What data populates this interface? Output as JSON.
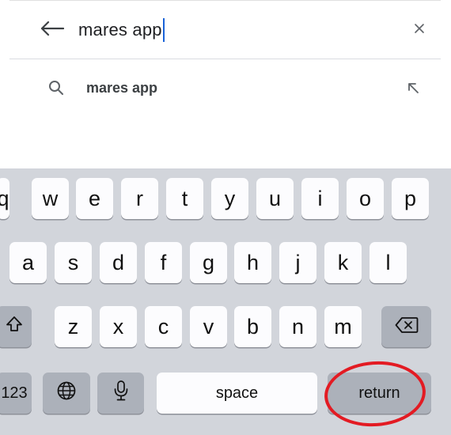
{
  "search": {
    "query": "mares app",
    "back_icon": "arrow-left-icon",
    "clear_icon": "close-icon"
  },
  "suggestions": [
    {
      "text": "mares app",
      "icon": "search-icon",
      "fill_icon": "arrow-up-left-icon"
    }
  ],
  "keyboard": {
    "row1": [
      "q",
      "w",
      "e",
      "r",
      "t",
      "y",
      "u",
      "i",
      "o",
      "p"
    ],
    "row2": [
      "a",
      "s",
      "d",
      "f",
      "g",
      "h",
      "j",
      "k",
      "l"
    ],
    "row3": [
      "z",
      "x",
      "c",
      "v",
      "b",
      "n",
      "m"
    ],
    "shift_icon": "shift-icon",
    "delete_icon": "delete-icon",
    "numbers_label": "123",
    "globe_icon": "globe-icon",
    "mic_icon": "microphone-icon",
    "space_label": "space",
    "return_label": "return"
  },
  "annotation": {
    "color": "#e31b23",
    "target": "return key"
  }
}
